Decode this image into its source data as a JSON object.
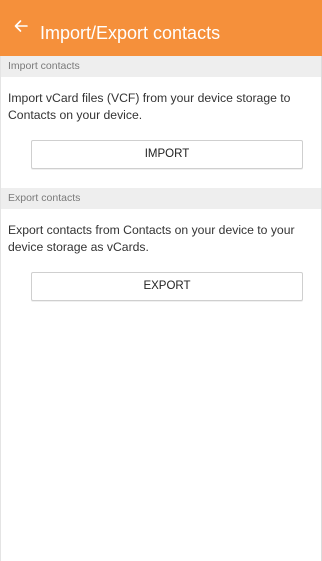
{
  "header": {
    "back_icon": "arrow-left-icon",
    "title": "Import/Export contacts",
    "background_color": "#f5903b"
  },
  "import_section": {
    "header": "Import contacts",
    "description": "Import vCard files (VCF) from your device storage to Contacts on your device.",
    "button_label": "IMPORT"
  },
  "export_section": {
    "header": "Export contacts",
    "description": "Export contacts from Contacts on your device to your device storage as vCards.",
    "button_label": "EXPORT"
  }
}
